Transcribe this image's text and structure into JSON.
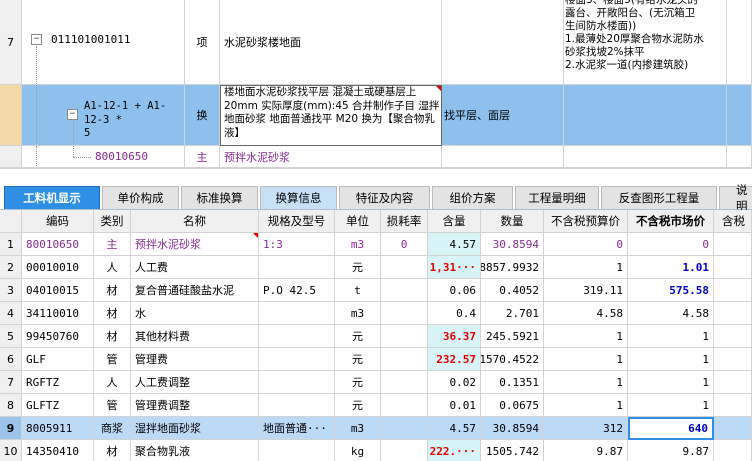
{
  "top_rows": [
    {
      "num": "7",
      "code": "011101001011",
      "kind": "项",
      "name": "水泥砂浆楼地面",
      "feature": "",
      "desc": "楼面3、楼面5(有给水龙头的\n露台、开敞阳台、(无沉箱卫\n生间防水楼面))\n1.最薄处20厚聚合物水泥防水\n砂浆找坡2%抹平\n2.水泥浆一道(内掺建筑胶)"
    },
    {
      "num": "",
      "code": "A1-12-1 + A1-12-3 *\n5",
      "kind": "换",
      "name": "楼地面水泥砂浆找平层 混凝土或硬基层上 20mm 实际厚度(mm):45 合并制作子目 湿拌地面砂浆 地面普通找平 M20 换为【聚合物乳液】",
      "feature": "找平层、面层",
      "desc": ""
    },
    {
      "num": "",
      "code": "80010650",
      "kind": "主",
      "name": "预拌水泥砂浆",
      "feature": "",
      "desc": ""
    }
  ],
  "tabs": [
    "工料机显示",
    "单价构成",
    "标准换算",
    "换算信息",
    "特征及内容",
    "组价方案",
    "工程量明细",
    "反查图形工程量",
    "说明"
  ],
  "columns": [
    "编码",
    "类别",
    "名称",
    "规格及型号",
    "单位",
    "损耗率",
    "含量",
    "数量",
    "不含税预算价",
    "不含税市场价",
    "含税"
  ],
  "rows": [
    {
      "n": "1",
      "code": "80010650",
      "cat": "主",
      "name": "预拌水泥砂浆",
      "spec": "1:3",
      "unit": "m3",
      "loss": "0",
      "qty": "4.57",
      "amount": "30.8594",
      "budget": "0",
      "market": "0"
    },
    {
      "n": "2",
      "code": "00010010",
      "cat": "人",
      "name": "人工费",
      "spec": "",
      "unit": "元",
      "loss": "",
      "qty": "1,31···",
      "amount": "8857.9932",
      "budget": "1",
      "market": "1.01"
    },
    {
      "n": "3",
      "code": "04010015",
      "cat": "材",
      "name": "复合普通硅酸盐水泥",
      "spec": "P.O 42.5",
      "unit": "t",
      "loss": "",
      "qty": "0.06",
      "amount": "0.4052",
      "budget": "319.11",
      "market": "575.58"
    },
    {
      "n": "4",
      "code": "34110010",
      "cat": "材",
      "name": "水",
      "spec": "",
      "unit": "m3",
      "loss": "",
      "qty": "0.4",
      "amount": "2.701",
      "budget": "4.58",
      "market": "4.58"
    },
    {
      "n": "5",
      "code": "99450760",
      "cat": "材",
      "name": "其他材料费",
      "spec": "",
      "unit": "元",
      "loss": "",
      "qty": "36.37",
      "amount": "245.5921",
      "budget": "1",
      "market": "1"
    },
    {
      "n": "6",
      "code": "GLF",
      "cat": "管",
      "name": "管理费",
      "spec": "",
      "unit": "元",
      "loss": "",
      "qty": "232.57",
      "amount": "1570.4522",
      "budget": "1",
      "market": "1"
    },
    {
      "n": "7",
      "code": "RGFTZ",
      "cat": "人",
      "name": "人工费调整",
      "spec": "",
      "unit": "元",
      "loss": "",
      "qty": "0.02",
      "amount": "0.1351",
      "budget": "1",
      "market": "1"
    },
    {
      "n": "8",
      "code": "GLFTZ",
      "cat": "管",
      "name": "管理费调整",
      "spec": "",
      "unit": "元",
      "loss": "",
      "qty": "0.01",
      "amount": "0.0675",
      "budget": "1",
      "market": "1"
    },
    {
      "n": "9",
      "code": "8005911",
      "cat": "商浆",
      "name": "湿拌地面砂浆",
      "spec": "地面普通···",
      "unit": "m3",
      "loss": "",
      "qty": "4.57",
      "amount": "30.8594",
      "budget": "312",
      "market": "640"
    },
    {
      "n": "10",
      "code": "14350410",
      "cat": "材",
      "name": "聚合物乳液",
      "spec": "",
      "unit": "kg",
      "loss": "",
      "qty": "222.···",
      "amount": "1505.742",
      "budget": "9.87",
      "market": "9.87"
    }
  ],
  "colors": {
    "accent": "#2f8fe6",
    "highlight": "#8ec0ee",
    "red": "#e00000",
    "blue": "#0000cc",
    "purple": "#8a2a9a"
  }
}
